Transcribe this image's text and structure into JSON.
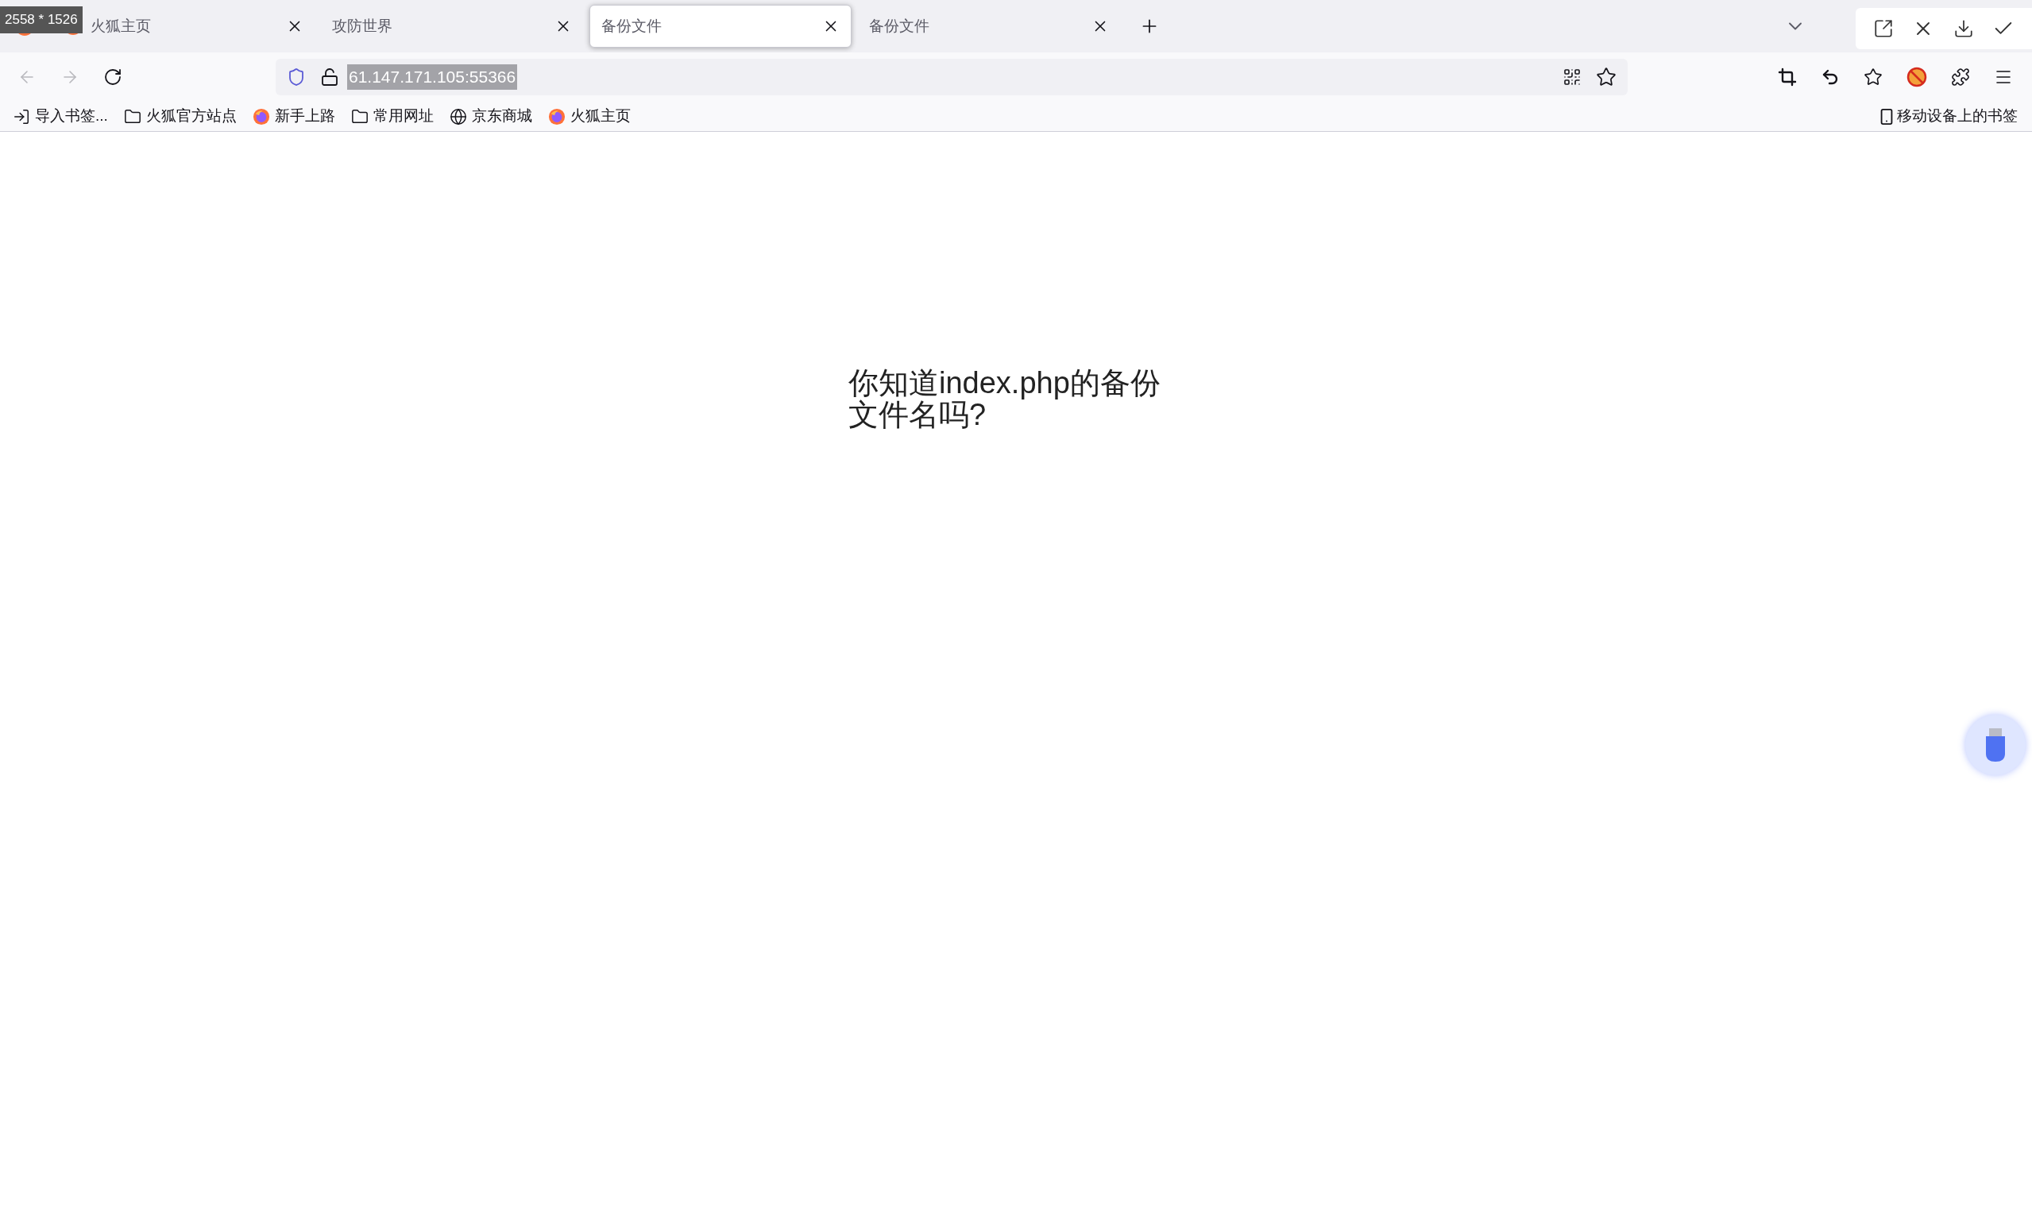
{
  "capture_overlay": {
    "size_label": "2558 * 1526"
  },
  "tabs": [
    {
      "title": "火狐主页",
      "kind": "firefox",
      "selected": false
    },
    {
      "title": "攻防世界",
      "kind": "plain",
      "selected": false
    },
    {
      "title": "备份文件",
      "kind": "plain",
      "selected": true
    },
    {
      "title": "备份文件",
      "kind": "plain",
      "selected": false
    }
  ],
  "address_bar": {
    "url": "61.147.171.105:55366",
    "selected": true
  },
  "bookmarks": [
    {
      "label": "导入书签...",
      "kind": "import"
    },
    {
      "label": "火狐官方站点",
      "kind": "folder"
    },
    {
      "label": "新手上路",
      "kind": "firefox"
    },
    {
      "label": "常用网址",
      "kind": "folder"
    },
    {
      "label": "京东商城",
      "kind": "globe"
    },
    {
      "label": "火狐主页",
      "kind": "firefox"
    }
  ],
  "mobile_bookmarks": {
    "label": "移动设备上的书签"
  },
  "page": {
    "heading": "你知道index.php的备份文件名吗?"
  }
}
